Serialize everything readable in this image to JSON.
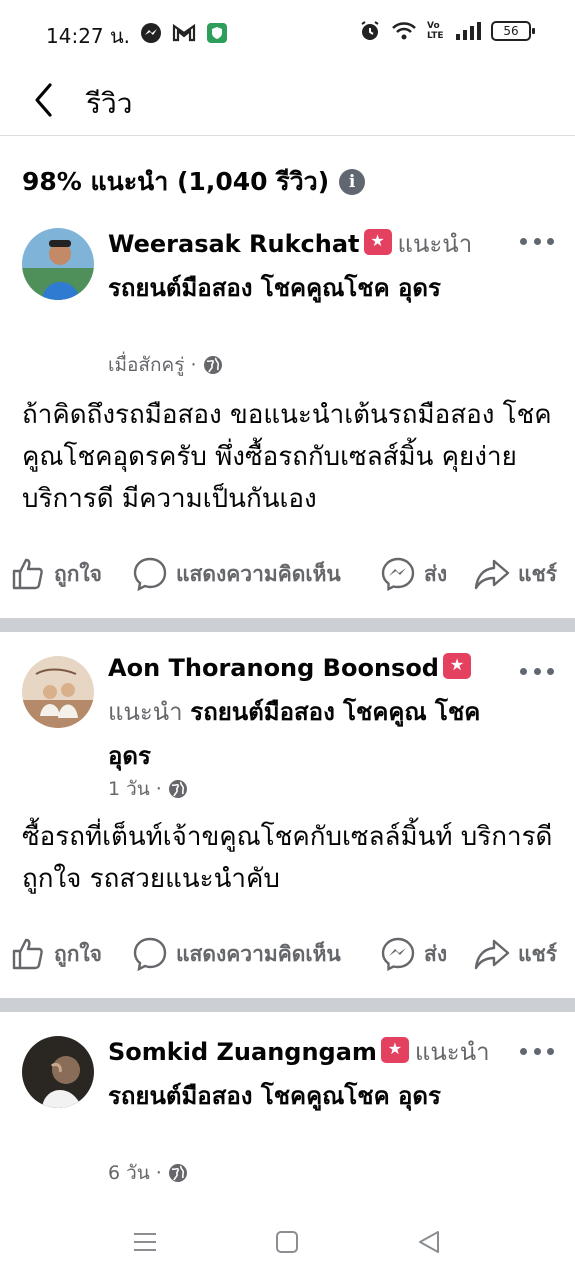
{
  "status_bar": {
    "time": "14:27 น.",
    "battery": "56",
    "network": "Vo LTE"
  },
  "header": {
    "title": "รีวิว"
  },
  "summary": {
    "text": "98% แนะนำ (1,040 รีวิว)"
  },
  "reviews": [
    {
      "author": "Weerasak Rukchat",
      "recommend": "แนะนำ",
      "page": "รถยนต์มือสอง โชคคูณโชค อุดร",
      "time": "เมื่อสักครู่",
      "text": "ถ้าคิดถึงรถมือสอง ขอแนะนำเต้นรถมือสอง โชคคูณโชคอุดรครับ พึ่งซื้อรถกับเซลส์มิ้น คุยง่าย บริการดี มีความเป็นกันเอง"
    },
    {
      "author": "Aon Thoranong Boonsod",
      "recommend": "แนะนำ",
      "page": "รถยนต์มือสอง โชคคูณ โชค อุดร",
      "time": "1 วัน",
      "text": "ซื้อรถที่เต็นท์เจ้าขคูณโชคกับเซลล์มิ้นท์ บริการดีถูกใจ รถสวยแนะนำคับ"
    },
    {
      "author": "Somkid Zuangngam",
      "recommend": "แนะนำ",
      "page": "รถยนต์มือสอง โชคคูณโชค อุดร",
      "time": "6 วัน"
    }
  ],
  "actions": {
    "like": "ถูกใจ",
    "comment": "แสดงความคิดเห็น",
    "send": "ส่ง",
    "share": "แชร์"
  },
  "colors": {
    "secondary_text": "#65676b",
    "badge": "#e4405f",
    "divider": "#ccd0d5"
  }
}
